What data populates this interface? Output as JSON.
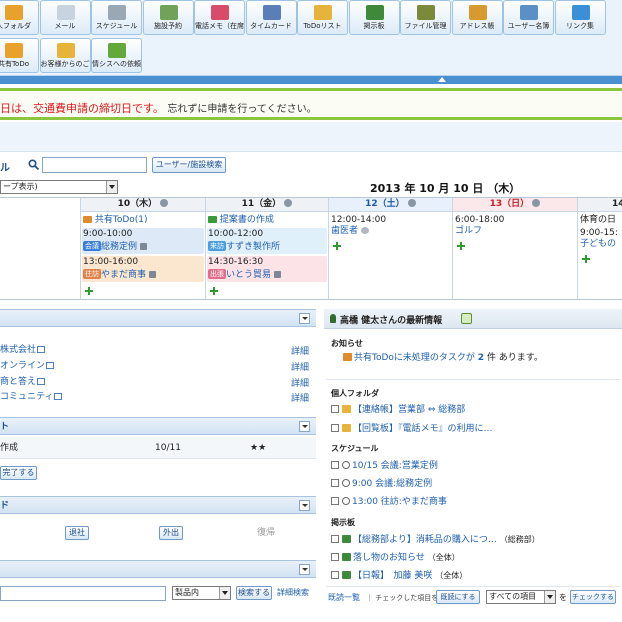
{
  "toolbar": {
    "row1": [
      {
        "label": "人フォルダ",
        "icon": "folder-icon",
        "color": "#e8a12b"
      },
      {
        "label": "メール",
        "icon": "mail-icon",
        "color": "#c7d3df"
      },
      {
        "label": "スケジュール",
        "icon": "calendar-icon",
        "color": "#9aa7b4"
      },
      {
        "label": "施設予約",
        "icon": "facility-icon",
        "color": "#6fa35a"
      },
      {
        "label": "電話メモ（在席",
        "icon": "phone-memo-icon",
        "color": "#d84b6a"
      },
      {
        "label": "タイムカード",
        "icon": "timecard-icon",
        "color": "#5a7fb8"
      },
      {
        "label": "ToDoリスト",
        "icon": "todo-list-icon",
        "color": "#e6b43a"
      },
      {
        "label": "掲示板",
        "icon": "bulletin-board-icon",
        "color": "#3f8a3a"
      },
      {
        "label": "ファイル管理",
        "icon": "file-manager-icon",
        "color": "#7a8a3a"
      },
      {
        "label": "アドレス帳",
        "icon": "address-book-icon",
        "color": "#d69a2e"
      },
      {
        "label": "ユーザー名簿",
        "icon": "user-directory-icon",
        "color": "#5b8fc7"
      },
      {
        "label": "リンク集",
        "icon": "globe-icon",
        "color": "#3b8fd6"
      }
    ],
    "row2": [
      {
        "label": "共有ToDo",
        "icon": "shared-todo-icon",
        "color": "#e8a12b"
      },
      {
        "label": "お客様からのご",
        "icon": "customer-inquiry-icon",
        "color": "#e6b43a"
      },
      {
        "label": "情シスへの依頼",
        "icon": "it-request-icon",
        "color": "#62a83a"
      }
    ]
  },
  "notice": {
    "highlight": "日は、交通費申請の締切日です。",
    "message": "忘れずに申請を行ってください。"
  },
  "schedule": {
    "title": "ル",
    "search_button": "ユーザー/施設検索",
    "view_select": "ープ表示)",
    "date_title": "2013 年 10 月 10 日 （木）",
    "days": [
      {
        "header": "10（木）",
        "kind": "weekday"
      },
      {
        "header": "11（金）",
        "kind": "weekday"
      },
      {
        "header": "12（土）",
        "kind": "sat"
      },
      {
        "header": "13（日）",
        "kind": "sun"
      },
      {
        "header": "14",
        "kind": "weekday"
      }
    ],
    "d10": {
      "todo": "共有ToDo(1)",
      "ev1_time": "9:00-10:00",
      "ev1_tag": "会議",
      "ev1_title": "総務定例",
      "ev2_time": "13:00-16:00",
      "ev2_tag": "往訪",
      "ev2_title": "やまだ商事"
    },
    "d11": {
      "todo": "提案書の作成",
      "ev1_time": "10:00-12:00",
      "ev1_tag": "来訪",
      "ev1_title": "すずき製作所",
      "ev2_time": "14:30-16:30",
      "ev2_tag": "出張",
      "ev2_title": "いとう貿易"
    },
    "d12": {
      "ev1_time": "12:00-14:00",
      "ev1_title": "歯医者"
    },
    "d13": {
      "ev1_time": "6:00-18:00",
      "ev1_title": "ゴルフ"
    },
    "d14": {
      "holiday": "体育の日",
      "ev1_time": "9:00-15:",
      "ev1_title": "子どもの"
    }
  },
  "links_portlet": {
    "items": [
      {
        "label": "株式会社",
        "detail": "詳細"
      },
      {
        "label": "オンライン",
        "detail": "詳細"
      },
      {
        "label": "商と答え",
        "detail": "詳細"
      },
      {
        "label": "コミュニティ",
        "detail": "詳細"
      }
    ]
  },
  "todo_portlet": {
    "title": "ト",
    "row_text": "作成",
    "row_date": "10/11",
    "row_priority": "★★",
    "complete_button": "完了する"
  },
  "timecard_portlet": {
    "title": "ド",
    "leave_button": "退社",
    "out_button": "外出",
    "return_label": "復帰"
  },
  "search_portlet": {
    "scope_select": "製品内",
    "search_button": "検索する",
    "advanced_link": "詳細検索"
  },
  "latest": {
    "title": "高橋 健太さんの最新情報",
    "notice_heading": "お知らせ",
    "notice_prefix": "共有ToDoに未処理のタスクが",
    "notice_count": "2",
    "notice_suffix": "件 あります。",
    "folder_heading": "個人フォルダ",
    "folder_items": [
      "【連絡帳】営業部 ⇔ 総務部",
      "【回覧板】『電話メモ』の利用に…"
    ],
    "schedule_heading": "スケジュール",
    "schedule_items": [
      "10/15 会議:営業定例",
      "9:00 会議:総務定例",
      "13:00 往訪:やまだ商事"
    ],
    "board_heading": "掲示板",
    "board_items": [
      {
        "title": "【総務部より】消耗品の購入につ…",
        "meta": "（総務部）"
      },
      {
        "title": "落し物のお知らせ",
        "meta": "（全体）"
      },
      {
        "title": "【日報】　加藤 美咲",
        "meta": "（全体）"
      }
    ],
    "footer_list_link": "既読一覧",
    "footer_text": "チェックした項目を",
    "footer_mark_button": "既読にする",
    "footer_select": "すべての項目",
    "footer_to": "を",
    "footer_check_button": "チェックする"
  },
  "colors": {
    "accent_blue": "#4a90d0",
    "notice_red": "#e0161a",
    "notice_border": "#8cc63f",
    "tag_meeting": "#3c7fd6",
    "tag_visit_out": "#e2824a",
    "tag_visit_in": "#4a9ee0",
    "tag_trip": "#e06e8a"
  }
}
